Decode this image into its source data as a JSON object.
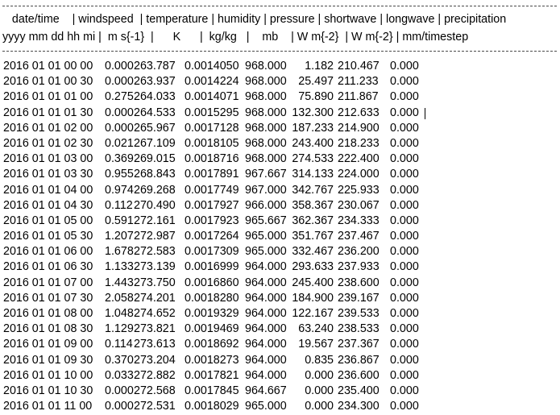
{
  "header": {
    "line1": "   date/time    | windspeed  | temperature | humidity | pressure | shortwave | longwave | precipitation",
    "line2": "yyyy mm dd hh mi |  m s{-1}  |      K      |  kg/kg   |    mb    | W m{-2}  | W m{-2} | mm/timestep"
  },
  "rows": [
    {
      "datetime": "2016 01 01 00 00",
      "windspeed": "0.000",
      "temperature": "263.787",
      "humidity": "0.0014050",
      "pressure": "968.000",
      "shortwave": "1.182",
      "longwave": "210.467",
      "precipitation": "0.000"
    },
    {
      "datetime": "2016 01 01 00 30",
      "windspeed": "0.000",
      "temperature": "263.937",
      "humidity": "0.0014224",
      "pressure": "968.000",
      "shortwave": "25.497",
      "longwave": "211.233",
      "precipitation": "0.000"
    },
    {
      "datetime": "2016 01 01 01 00",
      "windspeed": "0.275",
      "temperature": "264.033",
      "humidity": "0.0014071",
      "pressure": "968.000",
      "shortwave": "75.890",
      "longwave": "211.867",
      "precipitation": "0.000"
    },
    {
      "datetime": "2016 01 01 01 30",
      "windspeed": "0.000",
      "temperature": "264.533",
      "humidity": "0.0015295",
      "pressure": "968.000",
      "shortwave": "132.300",
      "longwave": "212.633",
      "precipitation": "0.000"
    },
    {
      "datetime": "2016 01 01 02 00",
      "windspeed": "0.000",
      "temperature": "265.967",
      "humidity": "0.0017128",
      "pressure": "968.000",
      "shortwave": "187.233",
      "longwave": "214.900",
      "precipitation": "0.000"
    },
    {
      "datetime": "2016 01 01 02 30",
      "windspeed": "0.021",
      "temperature": "267.109",
      "humidity": "0.0018105",
      "pressure": "968.000",
      "shortwave": "243.400",
      "longwave": "218.233",
      "precipitation": "0.000"
    },
    {
      "datetime": "2016 01 01 03 00",
      "windspeed": "0.369",
      "temperature": "269.015",
      "humidity": "0.0018716",
      "pressure": "968.000",
      "shortwave": "274.533",
      "longwave": "222.400",
      "precipitation": "0.000"
    },
    {
      "datetime": "2016 01 01 03 30",
      "windspeed": "0.955",
      "temperature": "268.843",
      "humidity": "0.0017891",
      "pressure": "967.667",
      "shortwave": "314.133",
      "longwave": "224.000",
      "precipitation": "0.000"
    },
    {
      "datetime": "2016 01 01 04 00",
      "windspeed": "0.974",
      "temperature": "269.268",
      "humidity": "0.0017749",
      "pressure": "967.000",
      "shortwave": "342.767",
      "longwave": "225.933",
      "precipitation": "0.000"
    },
    {
      "datetime": "2016 01 01 04 30",
      "windspeed": "0.112",
      "temperature": "270.490",
      "humidity": "0.0017927",
      "pressure": "966.000",
      "shortwave": "358.367",
      "longwave": "230.067",
      "precipitation": "0.000"
    },
    {
      "datetime": "2016 01 01 05 00",
      "windspeed": "0.591",
      "temperature": "272.161",
      "humidity": "0.0017923",
      "pressure": "965.667",
      "shortwave": "362.367",
      "longwave": "234.333",
      "precipitation": "0.000"
    },
    {
      "datetime": "2016 01 01 05 30",
      "windspeed": "1.207",
      "temperature": "272.987",
      "humidity": "0.0017264",
      "pressure": "965.000",
      "shortwave": "351.767",
      "longwave": "237.467",
      "precipitation": "0.000"
    },
    {
      "datetime": "2016 01 01 06 00",
      "windspeed": "1.678",
      "temperature": "272.583",
      "humidity": "0.0017309",
      "pressure": "965.000",
      "shortwave": "332.467",
      "longwave": "236.200",
      "precipitation": "0.000"
    },
    {
      "datetime": "2016 01 01 06 30",
      "windspeed": "1.133",
      "temperature": "273.139",
      "humidity": "0.0016999",
      "pressure": "964.000",
      "shortwave": "293.633",
      "longwave": "237.933",
      "precipitation": "0.000"
    },
    {
      "datetime": "2016 01 01 07 00",
      "windspeed": "1.443",
      "temperature": "273.750",
      "humidity": "0.0016860",
      "pressure": "964.000",
      "shortwave": "245.400",
      "longwave": "238.600",
      "precipitation": "0.000"
    },
    {
      "datetime": "2016 01 01 07 30",
      "windspeed": "2.058",
      "temperature": "274.201",
      "humidity": "0.0018280",
      "pressure": "964.000",
      "shortwave": "184.900",
      "longwave": "239.167",
      "precipitation": "0.000"
    },
    {
      "datetime": "2016 01 01 08 00",
      "windspeed": "1.048",
      "temperature": "274.652",
      "humidity": "0.0019329",
      "pressure": "964.000",
      "shortwave": "122.167",
      "longwave": "239.533",
      "precipitation": "0.000"
    },
    {
      "datetime": "2016 01 01 08 30",
      "windspeed": "1.129",
      "temperature": "273.821",
      "humidity": "0.0019469",
      "pressure": "964.000",
      "shortwave": "63.240",
      "longwave": "238.533",
      "precipitation": "0.000"
    },
    {
      "datetime": "2016 01 01 09 00",
      "windspeed": "0.114",
      "temperature": "273.613",
      "humidity": "0.0018692",
      "pressure": "964.000",
      "shortwave": "19.567",
      "longwave": "237.367",
      "precipitation": "0.000"
    },
    {
      "datetime": "2016 01 01 09 30",
      "windspeed": "0.370",
      "temperature": "273.204",
      "humidity": "0.0018273",
      "pressure": "964.000",
      "shortwave": "0.835",
      "longwave": "236.867",
      "precipitation": "0.000"
    },
    {
      "datetime": "2016 01 01 10 00",
      "windspeed": "0.033",
      "temperature": "272.882",
      "humidity": "0.0017821",
      "pressure": "964.000",
      "shortwave": "0.000",
      "longwave": "236.600",
      "precipitation": "0.000"
    },
    {
      "datetime": "2016 01 01 10 30",
      "windspeed": "0.000",
      "temperature": "272.568",
      "humidity": "0.0017845",
      "pressure": "964.667",
      "shortwave": "0.000",
      "longwave": "235.400",
      "precipitation": "0.000"
    },
    {
      "datetime": "2016 01 01 11 00",
      "windspeed": "0.000",
      "temperature": "272.531",
      "humidity": "0.0018029",
      "pressure": "965.000",
      "shortwave": "0.000",
      "longwave": "234.300",
      "precipitation": "0.000"
    }
  ]
}
